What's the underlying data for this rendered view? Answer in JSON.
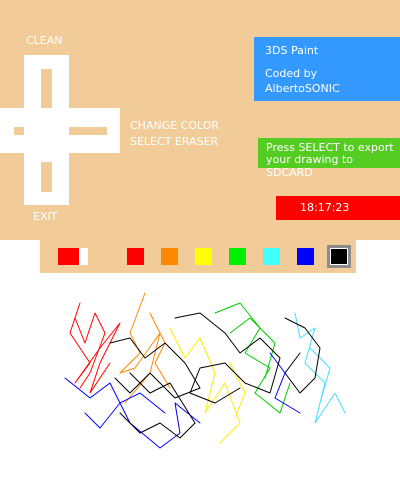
{
  "top": {
    "clean_label": "CLEAN",
    "exit_label": "EXIT",
    "change_color_label": "CHANGE COLOR",
    "select_eraser_label": "SELECT ERASER",
    "app_title": "3DS Paint",
    "credits_line1": "Coded by",
    "credits_line2": "AlbertoSONIC",
    "export_line1": "Press SELECT to export",
    "export_line2": "your drawing to SDCARD",
    "clock": "18:17:23"
  },
  "palette": {
    "current_color": "#ff0000",
    "colors": [
      "#ff0000",
      "#ff8800",
      "#ffff00",
      "#00ee00",
      "#44ffff",
      "#0000ff",
      "#000000"
    ],
    "selected_index": 6
  },
  "colors": {
    "background": "#f2cc98",
    "title_box": "#3399ff",
    "export_box": "#55cc22",
    "clock_box": "#ff0000"
  }
}
